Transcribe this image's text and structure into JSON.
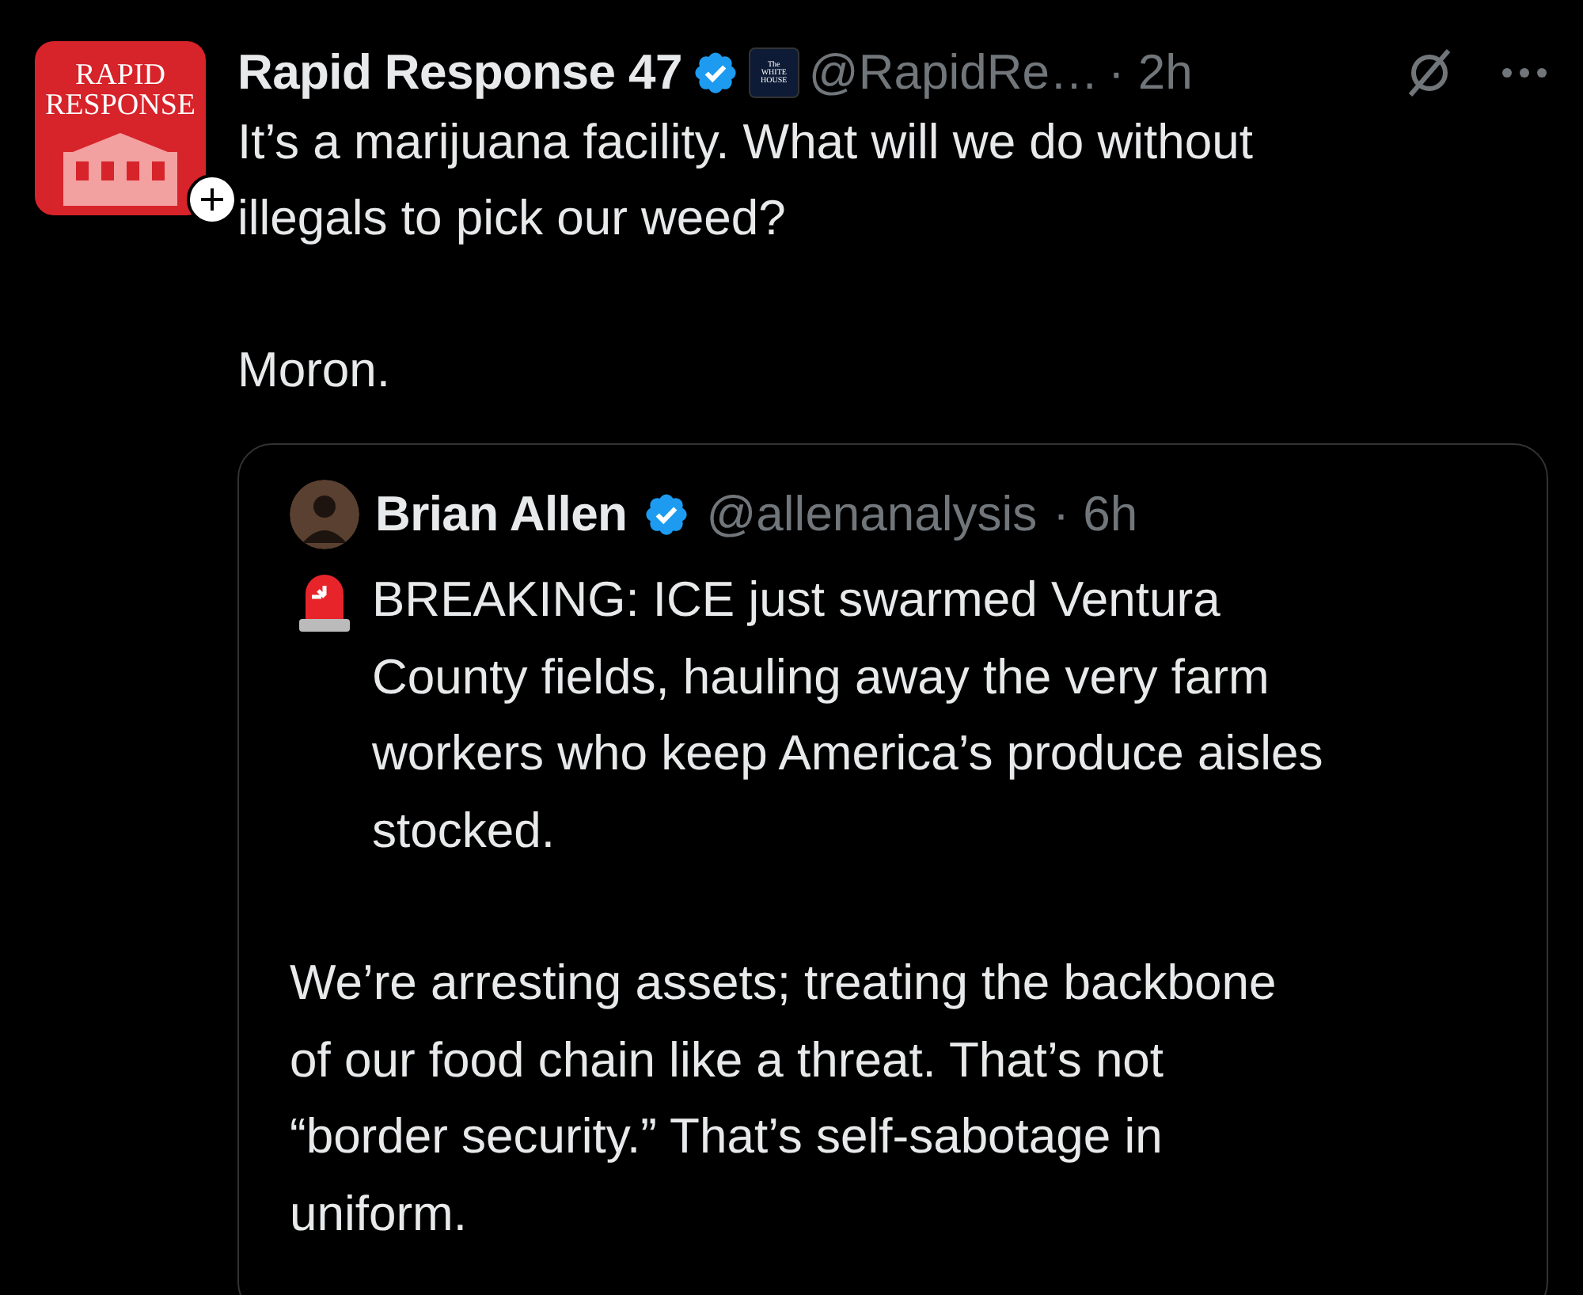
{
  "post": {
    "avatar_text": "RAPID\nRESPONSE",
    "name": "Rapid Response 47",
    "verified": true,
    "affiliate_badge": "The\nWHITE\nHOUSE",
    "handle": "@RapidRe…",
    "time": "· 2h",
    "paragraphs": [
      "It’s a marijuana facility. What will we do without\nillegals to pick our weed?",
      "Moron."
    ],
    "quote": {
      "name": "Brian Allen",
      "verified": true,
      "handle": "@allenanalysis",
      "time": "· 6h",
      "paragraphs": [
        "BREAKING: ICE just swarmed Ventura\nCounty fields, hauling away the very farm\nworkers who keep America’s produce aisles\nstocked.",
        "We’re arresting assets; treating the backbone\nof our food chain like a threat. That’s not\n“border security.” That’s self-sabotage in\nuniform."
      ]
    }
  }
}
